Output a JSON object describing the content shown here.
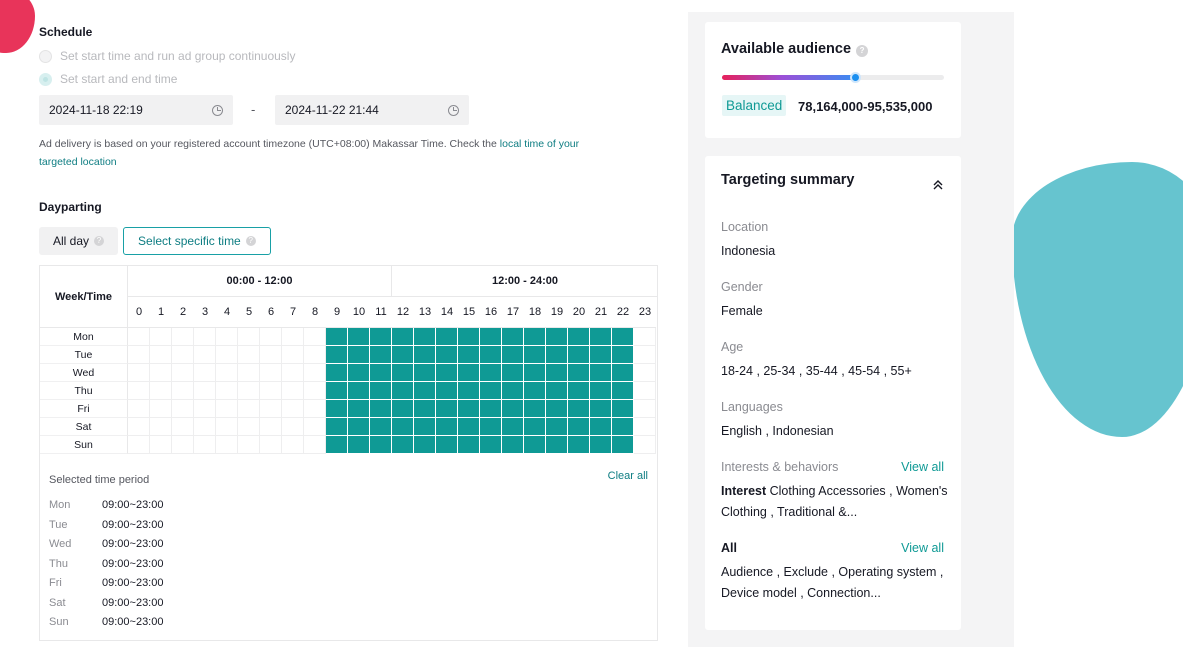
{
  "schedule": {
    "title": "Schedule",
    "option_continuous": "Set start time and run ad group continuously",
    "option_start_end": "Set start and end time",
    "start_date": "2024-11-18 22:19",
    "end_date": "2024-11-22 21:44",
    "separator": "-",
    "note_text": "Ad delivery is based on your registered account timezone (UTC+08:00) Makassar Time. Check the ",
    "note_link": "local time of your targeted location"
  },
  "dayparting": {
    "title": "Dayparting",
    "all_day": "All day",
    "specific_time": "Select specific time",
    "header_week_time": "Week/Time",
    "header_am": "00:00 - 12:00",
    "header_pm": "12:00 - 24:00",
    "hours": [
      "0",
      "1",
      "2",
      "3",
      "4",
      "5",
      "6",
      "7",
      "8",
      "9",
      "10",
      "11",
      "12",
      "13",
      "14",
      "15",
      "16",
      "17",
      "18",
      "19",
      "20",
      "21",
      "22",
      "23"
    ],
    "days": [
      "Mon",
      "Tue",
      "Wed",
      "Thu",
      "Fri",
      "Sat",
      "Sun"
    ],
    "selected_hours": [
      9,
      23
    ],
    "selected_period_label": "Selected time period",
    "clear_all": "Clear all",
    "selected_periods": [
      {
        "day": "Mon",
        "range": "09:00~23:00"
      },
      {
        "day": "Tue",
        "range": "09:00~23:00"
      },
      {
        "day": "Wed",
        "range": "09:00~23:00"
      },
      {
        "day": "Thu",
        "range": "09:00~23:00"
      },
      {
        "day": "Fri",
        "range": "09:00~23:00"
      },
      {
        "day": "Sat",
        "range": "09:00~23:00"
      },
      {
        "day": "Sun",
        "range": "09:00~23:00"
      }
    ]
  },
  "audience": {
    "title": "Available audience",
    "level": 0.6,
    "badge": "Balanced",
    "range": "78,164,000-95,535,000"
  },
  "targeting": {
    "title": "Targeting summary",
    "location_label": "Location",
    "location_value": "Indonesia",
    "gender_label": "Gender",
    "gender_value": "Female",
    "age_label": "Age",
    "age_value": "18-24 , 25-34 , 35-44 , 45-54 , 55+",
    "languages_label": "Languages",
    "languages_value": "English , Indonesian",
    "interests_label": "Interests & behaviors",
    "view_all": "View all",
    "interest_prefix": "Interest",
    "interest_value": " Clothing Accessories , Women's Clothing , Traditional &...",
    "all_label": "All",
    "all_value": "Audience , Exclude , Operating system , Device model , Connection..."
  }
}
